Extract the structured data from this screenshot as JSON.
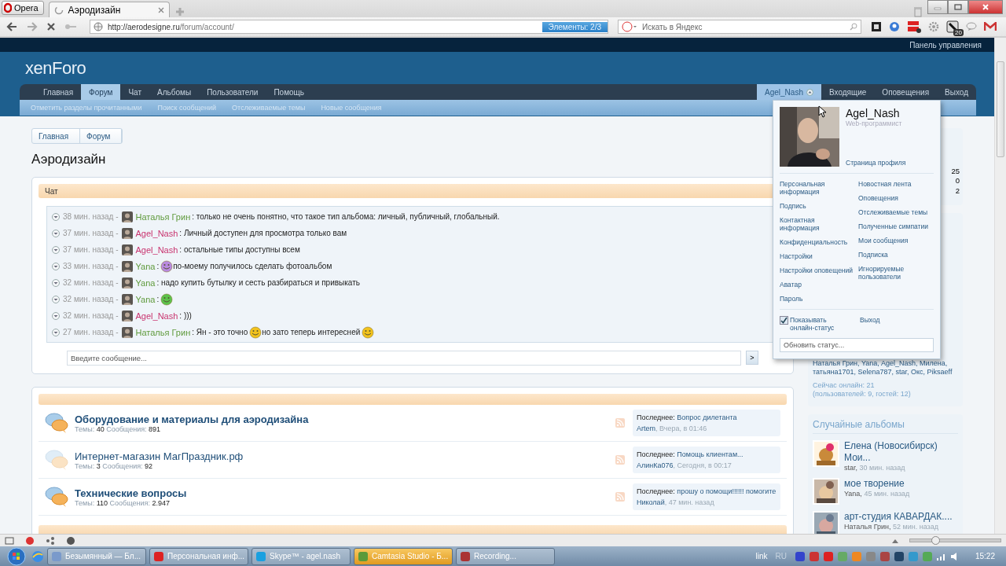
{
  "browser": {
    "menu_button": "Opera",
    "tab_title": "Аэродизайн",
    "url_host": "http://aerodesigne.ru",
    "url_path": "/forum/account/",
    "elements_badge": "Элементы:  2/3",
    "search_placeholder": "Искать в Яндекс",
    "notification_count": "20"
  },
  "top_bar": {
    "control_panel": "Панель управления"
  },
  "logo": "xenForo",
  "nav_tabs": [
    {
      "label": "Главная",
      "selected": false
    },
    {
      "label": "Форум",
      "selected": true
    },
    {
      "label": "Чат",
      "selected": false
    },
    {
      "label": "Альбомы",
      "selected": false
    },
    {
      "label": "Пользователи",
      "selected": false
    },
    {
      "label": "Помощь",
      "selected": false
    }
  ],
  "user_tabs": [
    {
      "label": "Agel_Nash",
      "selected": true
    },
    {
      "label": "Входящие",
      "selected": false
    },
    {
      "label": "Оповещения",
      "selected": false
    },
    {
      "label": "Выход",
      "selected": false
    }
  ],
  "sub_nav": [
    "Отметить разделы прочитанными",
    "Поиск сообщений",
    "Отслеживаемые темы",
    "Новые сообщения"
  ],
  "breadcrumbs": [
    "Главная",
    "Форум"
  ],
  "page_title": "Аэродизайн",
  "chat": {
    "title": "Чат",
    "input_placeholder": "Введите сообщение...",
    "send": ">",
    "messages": [
      {
        "time": "38 мин. назад -",
        "author": "Наталья Грин",
        "color": "#5f9a3c",
        "parts": [
          {
            "kind": "text",
            "text": ": только не очень понятно, что такое тип альбома: личный, публичный, глобальный."
          }
        ]
      },
      {
        "time": "37 мин. назад -",
        "author": "Agel_Nash",
        "color": "#c8336e",
        "parts": [
          {
            "kind": "text",
            "text": ": Личный доступен для просмотра только вам"
          }
        ]
      },
      {
        "time": "37 мин. назад -",
        "author": "Agel_Nash",
        "color": "#c8336e",
        "parts": [
          {
            "kind": "text",
            "text": ": остальные типы доступны всем"
          }
        ]
      },
      {
        "time": "33 мин. назад -",
        "author": "Yana",
        "color": "#5f9a3c",
        "parts": [
          {
            "kind": "text",
            "text": ":"
          },
          {
            "kind": "smiley",
            "color": "#b98ae0"
          },
          {
            "kind": "text",
            "text": "по-моему получилось сделать фотоальбом"
          }
        ]
      },
      {
        "time": "32 мин. назад -",
        "author": "Yana",
        "color": "#5f9a3c",
        "parts": [
          {
            "kind": "text",
            "text": ": надо купить бутылку и сесть разбираться и привыкать"
          }
        ]
      },
      {
        "time": "32 мин. назад -",
        "author": "Yana",
        "color": "#5f9a3c",
        "parts": [
          {
            "kind": "text",
            "text": ":"
          },
          {
            "kind": "smiley",
            "color": "#5cc24a"
          }
        ]
      },
      {
        "time": "32 мин. назад -",
        "author": "Agel_Nash",
        "color": "#c8336e",
        "parts": [
          {
            "kind": "text",
            "text": ": )))"
          }
        ]
      },
      {
        "time": "27 мин. назад -",
        "author": "Наталья Грин",
        "color": "#5f9a3c",
        "parts": [
          {
            "kind": "text",
            "text": ": Ян - это точно"
          },
          {
            "kind": "smiley",
            "color": "#f2c21c"
          },
          {
            "kind": "text",
            "text": "но зато теперь интересней"
          },
          {
            "kind": "smiley",
            "color": "#f2c21c"
          }
        ]
      }
    ]
  },
  "forums": [
    {
      "title": "Оборудование и материалы для аэродизайна",
      "unread": true,
      "threads_label": "Темы:",
      "threads": "40",
      "posts_label": "Сообщения:",
      "posts": "891",
      "last_label": "Последнее:",
      "last_title": "Вопрос дилетанта",
      "last_user": "Artem",
      "last_time": ", Вчера, в 01:46"
    },
    {
      "title": "Интернет-магазин МагПраздник.рф",
      "unread": false,
      "threads_label": "Темы:",
      "threads": "3",
      "posts_label": "Сообщения:",
      "posts": "92",
      "last_label": "Последнее:",
      "last_title": "Помощь клиентам...",
      "last_user": "АлинКа076",
      "last_time": ", Сегодня, в 00:17"
    },
    {
      "title": "Технические вопросы",
      "unread": true,
      "threads_label": "Темы:",
      "threads": "110",
      "posts_label": "Сообщения:",
      "posts": "2.947",
      "last_label": "Последнее:",
      "last_title": "прошу о помощи!!!!!! помогите",
      "last_user": "Николай",
      "last_time": ", 47 мин. назад"
    }
  ],
  "sidebar": {
    "stats": [
      "25",
      "0",
      "2"
    ],
    "online_users": "Наталья Грин, Yana, Agel_Nash, Милена, татьяна1701, Selena787, star, Окс, Piksaeff",
    "online_now": "Сейчас онлайн: 21",
    "online_detail": "(пользователей: 9, гостей: 12)",
    "albums_title": "Случайные альбомы",
    "albums": [
      {
        "title": "Елена (Новосибирск) Мои...",
        "author": "star,",
        "time": "30 мин. назад",
        "kind": "picture"
      },
      {
        "title": "мое творение",
        "author": "Yana,",
        "time": "45 мин. назад",
        "kind": "picture"
      },
      {
        "title": "арт-студия КАВАРДАК....",
        "author": "Наталья Грин,",
        "time": "52 мин. назад",
        "kind": "picture"
      }
    ]
  },
  "account_menu": {
    "name": "Agel_Nash",
    "user_title": "Web-программист",
    "profile_link": "Страница профиля",
    "left_links": [
      "Персональная информация",
      "Подпись",
      "Контактная информация",
      "Конфиденциальность",
      "Настройки",
      "Настройки оповещений",
      "Аватар",
      "Пароль"
    ],
    "right_links": [
      "Новостная лента",
      "Оповещения",
      "Отслеживаемые темы",
      "Полученные симпатии",
      "Мои сообщения",
      "Подписка",
      "Игнорируемые пользователи"
    ],
    "show_online": {
      "label": "Показывать онлайн-статус",
      "checked": true
    },
    "logout": "Выход",
    "status_placeholder": "Обновить статус..."
  },
  "zoom_slider": {
    "level": 0.28
  },
  "taskbar": {
    "items": [
      {
        "label": "Безымянный — Бл...",
        "highlighted": false
      },
      {
        "label": "Персональная инф...",
        "highlighted": false
      },
      {
        "label": "Skype™ - agel.nash",
        "highlighted": false
      },
      {
        "label": "Camtasia Studio - Б...",
        "highlighted": true
      },
      {
        "label": "Recording...",
        "highlighted": false
      }
    ],
    "link": "link",
    "language": "RU",
    "clock": "15:22"
  }
}
